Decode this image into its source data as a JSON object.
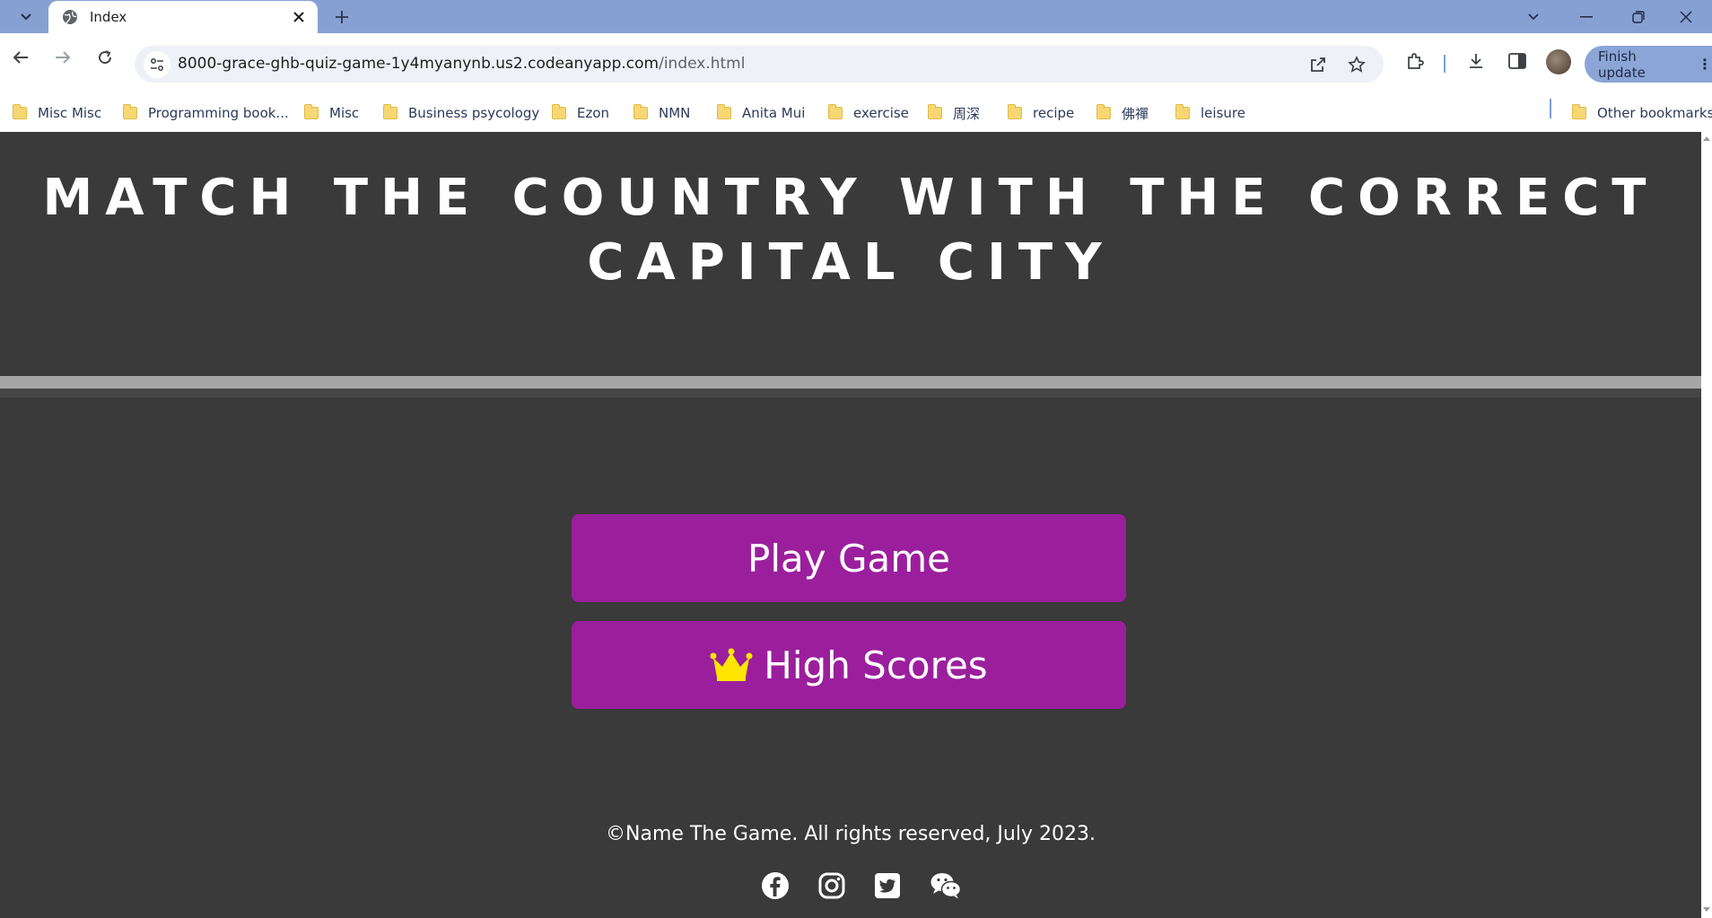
{
  "browser": {
    "tab": {
      "title": "Index"
    },
    "url": {
      "host": "8000-grace-ghb-quiz-game-1y4myanynb.us2.codeanyapp.com",
      "path": "/index.html"
    },
    "finish_update_label": "Finish update",
    "bookmarks": [
      {
        "label": "Misc Misc"
      },
      {
        "label": "Programming book..."
      },
      {
        "label": "Misc"
      },
      {
        "label": "Business psycology"
      },
      {
        "label": "Ezon"
      },
      {
        "label": "NMN"
      },
      {
        "label": "Anita Mui"
      },
      {
        "label": "exercise"
      },
      {
        "label": "周深"
      },
      {
        "label": "recipe"
      },
      {
        "label": "佛禪"
      },
      {
        "label": "leisure"
      }
    ],
    "other_bookmarks_label": "Other bookmarks"
  },
  "page": {
    "title": "MATCH THE COUNTRY WITH THE CORRECT CAPITAL CITY",
    "play_button_label": "Play Game",
    "high_scores_label": "High Scores",
    "footer_text": "©Name The Game. All rights reserved, July 2023.",
    "social_links": [
      "facebook-icon",
      "instagram-icon",
      "twitter-icon",
      "wechat-icon"
    ],
    "colors": {
      "background": "#3a3a3a",
      "button": "#9b1f9d",
      "crown": "#ffe600",
      "divider": "#a6a6a6"
    }
  }
}
